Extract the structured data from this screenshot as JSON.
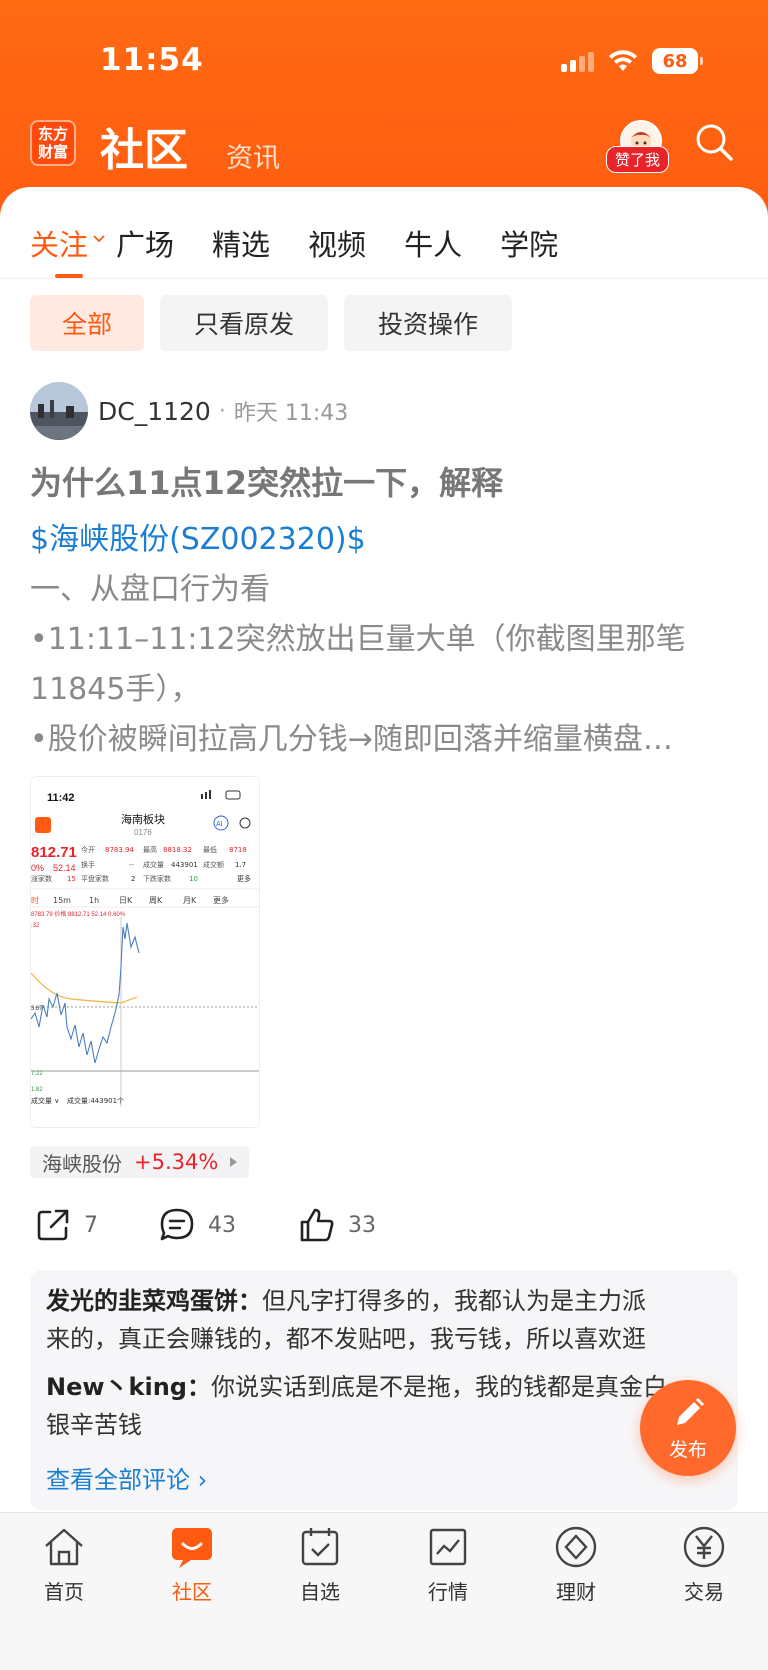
{
  "status": {
    "time": "11:54",
    "battery": "68"
  },
  "header": {
    "logo_line1": "东方",
    "logo_line2": "财富",
    "title": "社区",
    "subtitle": "资讯",
    "praise_badge": "赞了我"
  },
  "tabs": [
    {
      "label": "关注"
    },
    {
      "label": "广场"
    },
    {
      "label": "精选"
    },
    {
      "label": "视频"
    },
    {
      "label": "牛人"
    },
    {
      "label": "学院"
    }
  ],
  "filters": [
    {
      "label": "全部"
    },
    {
      "label": "只看原发"
    },
    {
      "label": "投资操作"
    }
  ],
  "post": {
    "user": "DC_1120",
    "dot": "·",
    "time": "昨天 11:43",
    "title": "为什么11点12突然拉一下，解释",
    "stock_link": "$海峡股份(SZ002320)$",
    "lines": [
      "一、从盘口行为看",
      "•11:11–11:12突然放出巨量大单（你截图里那笔",
      "11845手），",
      "•股价被瞬间拉高几分钱→随即回落并缩量横盘…"
    ],
    "tag": {
      "name": "海峡股份",
      "change": "+5.34%"
    },
    "actions": {
      "share": "7",
      "comment": "43",
      "like": "33"
    }
  },
  "thumbnail": {
    "time": "11:42",
    "title": "海南板块",
    "code": "0176",
    "price": "812.71",
    "change": "0%",
    "change_val": "52.14",
    "open_label": "今开",
    "open": "8783.94",
    "high_label": "最高",
    "high": "8818.32",
    "low_label": "最低",
    "low": "8718",
    "turnover_label": "换手",
    "turnover": "--",
    "volume_label": "成交量",
    "volume": "443901",
    "amount_label": "成交额",
    "amount": "1.7",
    "up_label": "涨家数",
    "up": "15",
    "flat_label": "平盘家数",
    "flat": "2",
    "down_label": "下跌家数",
    "down": "10",
    "more": "更多",
    "periods": [
      "时",
      "15m",
      "1h",
      "日K",
      "周K",
      "月K",
      "更多"
    ],
    "info": "8783.79 价格:8812.71 52.14 0.60%",
    "y_top": ".32",
    "y_mid": "3.67",
    "y_low": "7.22",
    "y_bottom": "1.82",
    "vol_label": "成交量 ∨",
    "vol_value": "成交量:443901个",
    "ai": "AI"
  },
  "comments": [
    {
      "user": "发光的韭菜鸡蛋饼：",
      "text": "但凡字打得多的，我都认为是主力派"
    },
    {
      "user": "",
      "text": "来的，真正会赚钱的，都不发贴吧，我亏钱，所以喜欢逛"
    },
    {
      "user": "New丶king：",
      "text": "你说实话到底是不是拖，我的钱都是真金白"
    },
    {
      "user": "",
      "text": "银辛苦钱"
    }
  ],
  "view_all": "查看全部评论 ›",
  "fab_label": "发布",
  "bottom_nav": [
    {
      "label": "首页"
    },
    {
      "label": "社区"
    },
    {
      "label": "自选"
    },
    {
      "label": "行情"
    },
    {
      "label": "理财"
    },
    {
      "label": "交易"
    }
  ],
  "colors": {
    "brand": "#ff5a10",
    "link": "#1a7fd4",
    "up": "#e8232a"
  }
}
